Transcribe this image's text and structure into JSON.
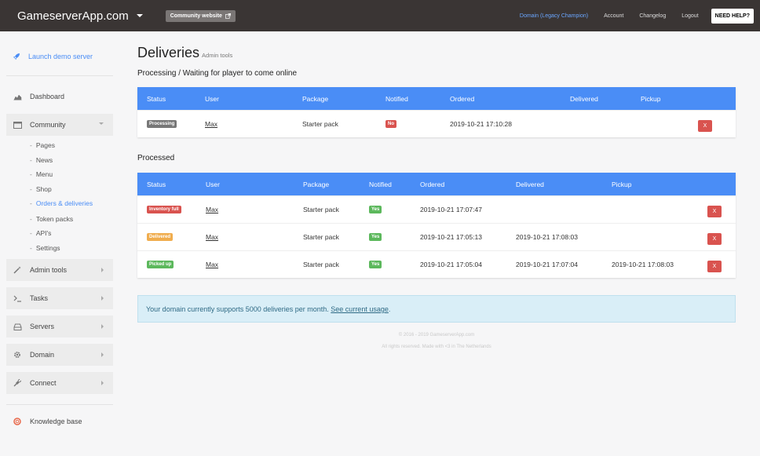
{
  "topbar": {
    "brand": "GameserverApp.com",
    "community_button": "Community website",
    "links": {
      "domain": "Domain (Legacy Champion)",
      "account": "Account",
      "changelog": "Changelog",
      "logout": "Logout"
    },
    "help_button": "NEED HELP?"
  },
  "sidebar": {
    "launch": "Launch demo server",
    "dashboard": "Dashboard",
    "community": "Community",
    "community_items": {
      "pages": "Pages",
      "news": "News",
      "menu": "Menu",
      "shop": "Shop",
      "orders": "Orders & deliveries",
      "token_packs": "Token packs",
      "apis": "API's",
      "settings": "Settings"
    },
    "admin_tools": "Admin tools",
    "tasks": "Tasks",
    "servers": "Servers",
    "domain": "Domain",
    "connect": "Connect",
    "knowledge_base": "Knowledge base"
  },
  "page": {
    "title": "Deliveries",
    "subtitle": "Admin tools"
  },
  "processing": {
    "title": "Processing / Waiting for player to come online",
    "headers": {
      "status": "Status",
      "user": "User",
      "package": "Package",
      "notified": "Notified",
      "ordered": "Ordered",
      "delivered": "Delivered",
      "pickup": "Pickup"
    },
    "rows": [
      {
        "status": "Processing",
        "user": "Max",
        "package": "Starter pack",
        "notified": "No",
        "ordered": "2019-10-21 17:10:28",
        "delete": "X"
      }
    ]
  },
  "processed": {
    "title": "Processed",
    "headers": {
      "status": "Status",
      "user": "User",
      "package": "Package",
      "notified": "Notified",
      "ordered": "Ordered",
      "delivered": "Delivered",
      "pickup": "Pickup"
    },
    "rows": [
      {
        "status": "Inventory full",
        "user": "Max",
        "package": "Starter pack",
        "notified": "Yes",
        "ordered": "2019-10-21 17:07:47",
        "delivered": "",
        "pickup": "",
        "delete": "X"
      },
      {
        "status": "Delivered",
        "user": "Max",
        "package": "Starter pack",
        "notified": "Yes",
        "ordered": "2019-10-21 17:05:13",
        "delivered": "2019-10-21 17:08:03",
        "pickup": "",
        "delete": "X"
      },
      {
        "status": "Picked up",
        "user": "Max",
        "package": "Starter pack",
        "notified": "Yes",
        "ordered": "2019-10-21 17:05:04",
        "delivered": "2019-10-21 17:07:04",
        "pickup": "2019-10-21 17:08:03",
        "delete": "X"
      }
    ]
  },
  "info": {
    "text": "Your domain currently supports 5000 deliveries per month. ",
    "link": "See current usage",
    "period": "."
  },
  "footer": {
    "line1": "© 2016 - 2019 GameserverApp.com",
    "line2": "All rights reserved. Made with <3 in The Netherlands"
  },
  "colors": {
    "topbar": "#3a3534",
    "accent": "#4a8df6",
    "danger": "#d9534f",
    "warning": "#f0ad4e",
    "success": "#5cb85c",
    "info_bg": "#d9eef7"
  }
}
